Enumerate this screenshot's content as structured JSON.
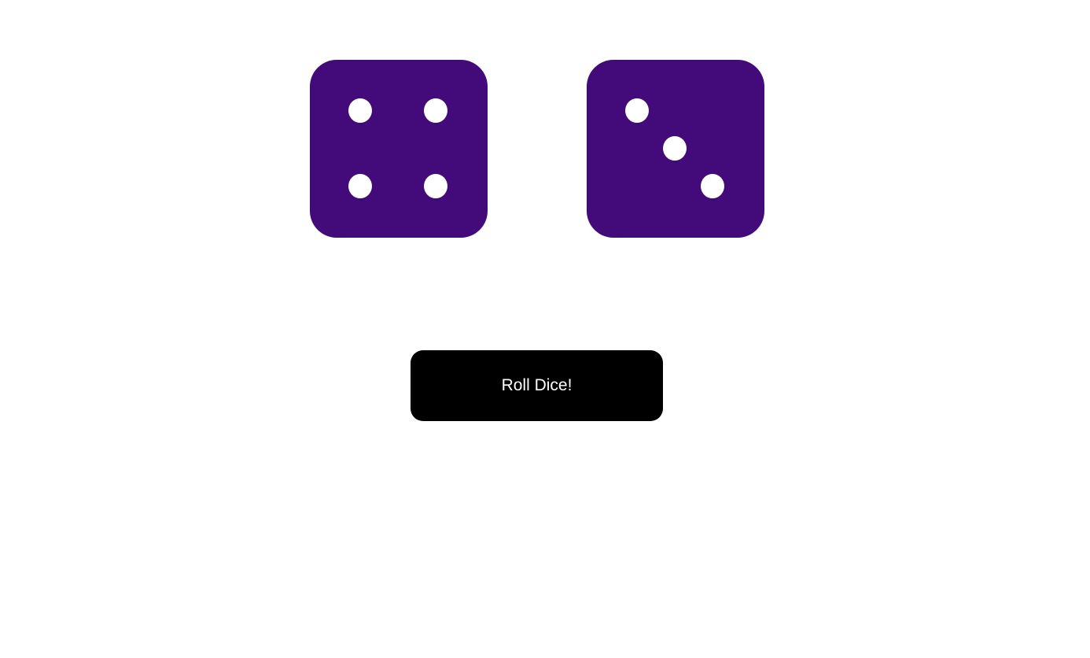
{
  "dice": [
    {
      "value": 4
    },
    {
      "value": 3
    }
  ],
  "die_color": "#430a79",
  "pip_color": "#ffffff",
  "roll_button": {
    "label": "Roll Dice!",
    "background": "#000000",
    "text_color": "#ffffff"
  }
}
